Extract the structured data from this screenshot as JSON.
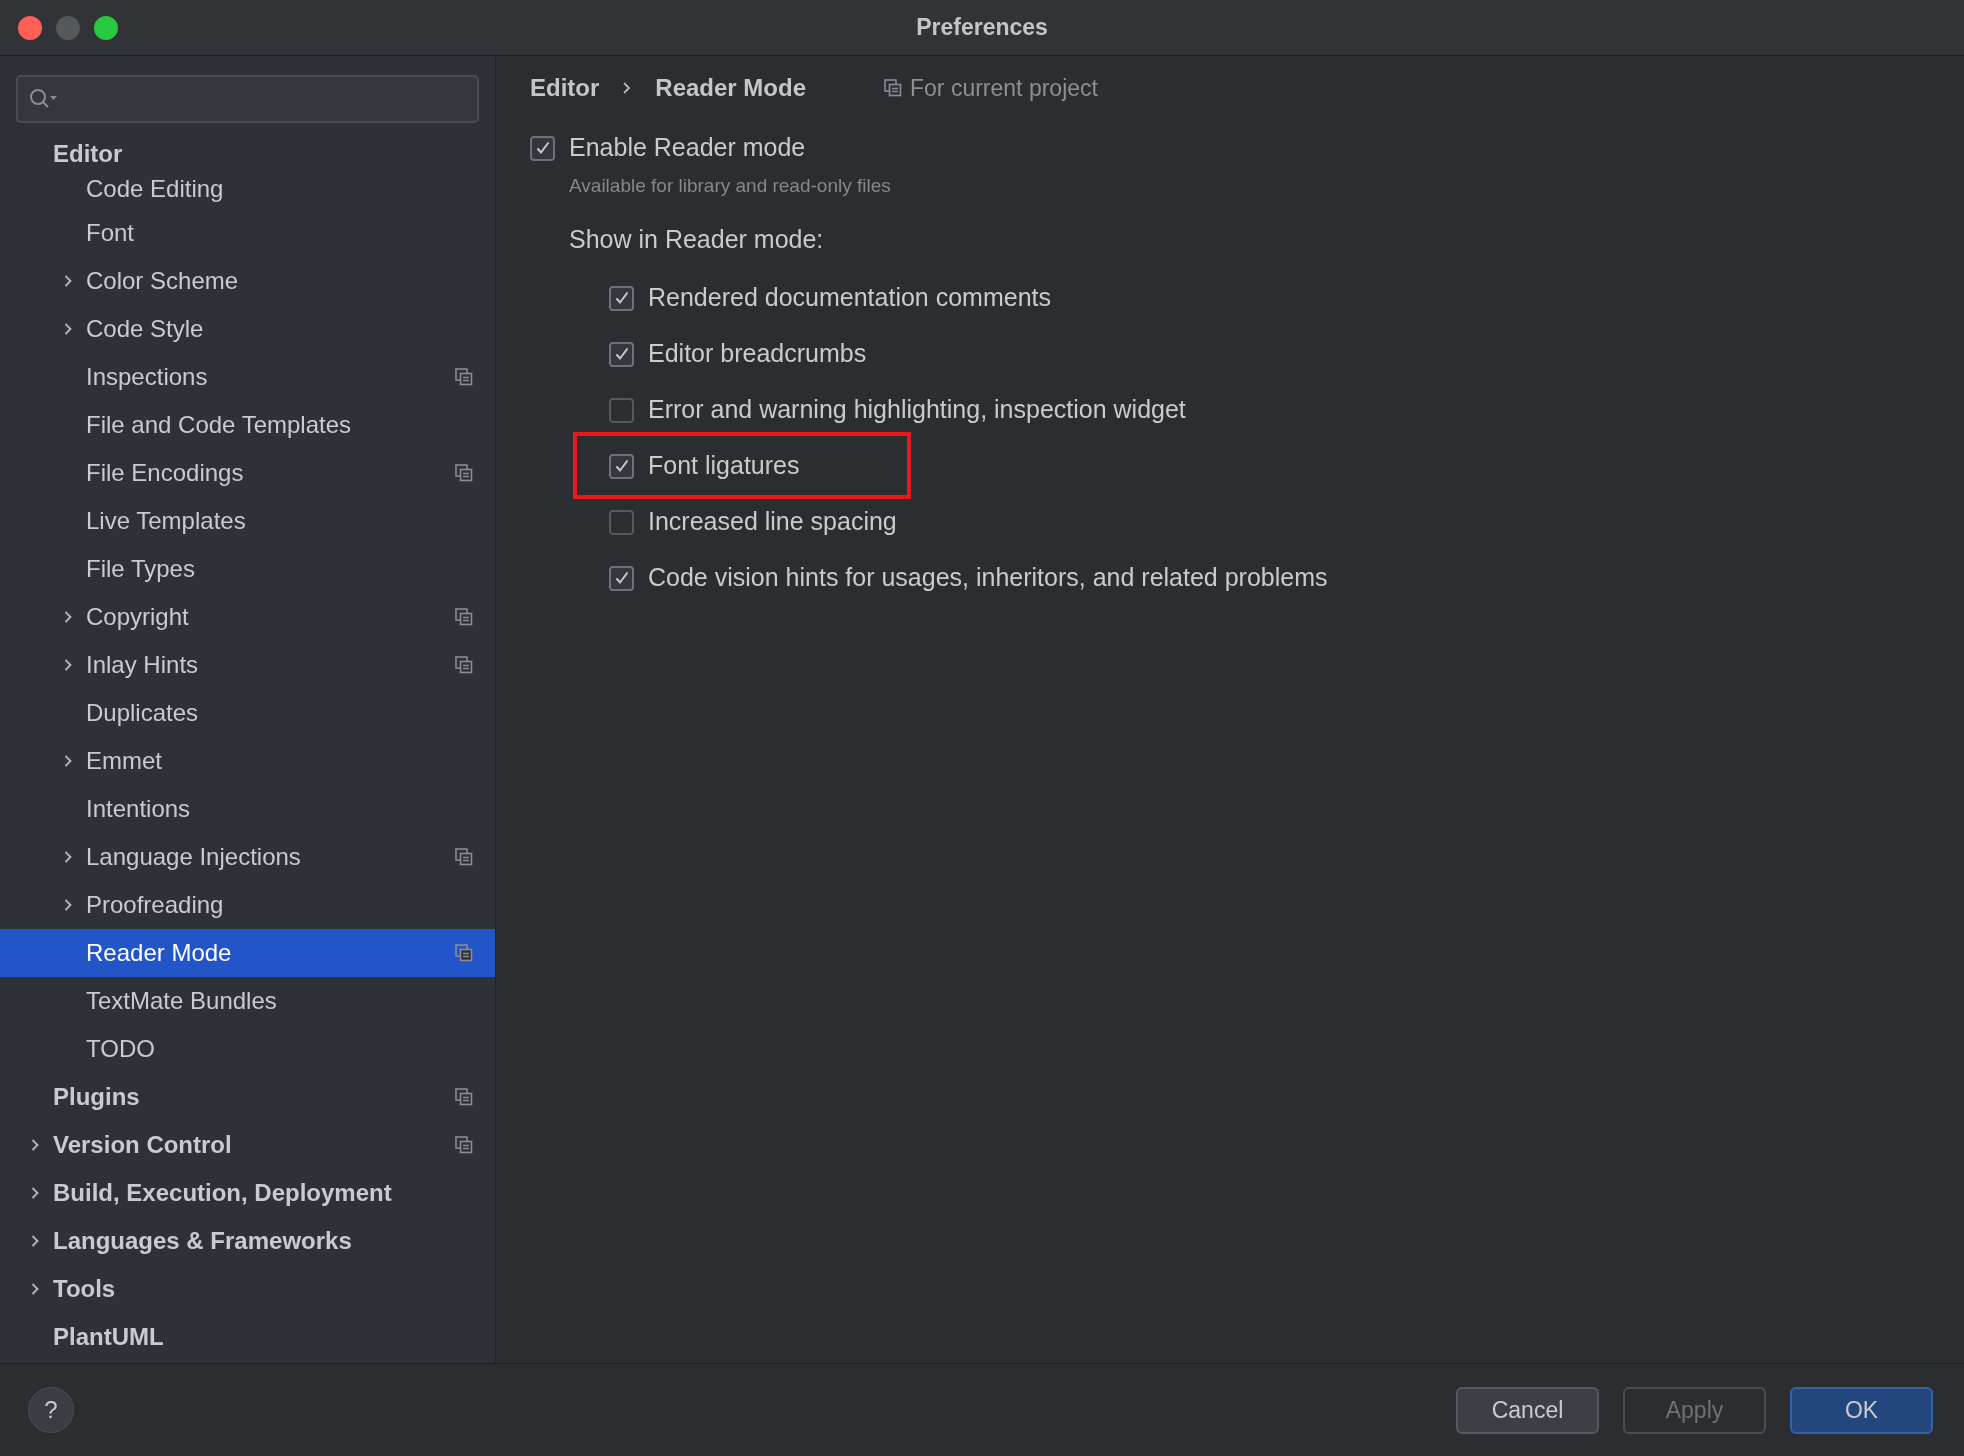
{
  "window": {
    "title": "Preferences"
  },
  "sidebar": {
    "items": [
      {
        "label": "Editor",
        "selected": false,
        "per_project": false,
        "children": [
          {
            "label": "Code Editing",
            "selected": false,
            "per_project": false
          },
          {
            "label": "Font",
            "selected": false,
            "per_project": false
          },
          {
            "label": "Color Scheme",
            "selected": false,
            "per_project": false,
            "expanded": false
          },
          {
            "label": "Code Style",
            "selected": false,
            "per_project": false,
            "expanded": false
          },
          {
            "label": "Inspections",
            "selected": false,
            "per_project": true
          },
          {
            "label": "File and Code Templates",
            "selected": false,
            "per_project": false
          },
          {
            "label": "File Encodings",
            "selected": false,
            "per_project": true
          },
          {
            "label": "Live Templates",
            "selected": false,
            "per_project": false
          },
          {
            "label": "File Types",
            "selected": false,
            "per_project": false
          },
          {
            "label": "Copyright",
            "selected": false,
            "per_project": true,
            "expanded": false
          },
          {
            "label": "Inlay Hints",
            "selected": false,
            "per_project": true,
            "expanded": false
          },
          {
            "label": "Duplicates",
            "selected": false,
            "per_project": false
          },
          {
            "label": "Emmet",
            "selected": false,
            "per_project": false,
            "expanded": false
          },
          {
            "label": "Intentions",
            "selected": false,
            "per_project": false
          },
          {
            "label": "Language Injections",
            "selected": false,
            "per_project": true,
            "expanded": false
          },
          {
            "label": "Proofreading",
            "selected": false,
            "per_project": false,
            "expanded": false
          },
          {
            "label": "Reader Mode",
            "selected": true,
            "per_project": true
          },
          {
            "label": "TextMate Bundles",
            "selected": false,
            "per_project": false
          },
          {
            "label": "TODO",
            "selected": false,
            "per_project": false
          }
        ]
      },
      {
        "label": "Plugins",
        "selected": false,
        "per_project": true
      },
      {
        "label": "Version Control",
        "selected": false,
        "per_project": true,
        "expanded": false
      },
      {
        "label": "Build, Execution, Deployment",
        "selected": false,
        "per_project": false,
        "expanded": false
      },
      {
        "label": "Languages & Frameworks",
        "selected": false,
        "per_project": false,
        "expanded": false
      },
      {
        "label": "Tools",
        "selected": false,
        "per_project": false,
        "expanded": false
      },
      {
        "label": "PlantUML",
        "selected": false,
        "per_project": false
      }
    ]
  },
  "breadcrumb": {
    "path": [
      "Editor",
      "Reader Mode"
    ],
    "scope": "For current project"
  },
  "enable": {
    "label": "Enable Reader mode",
    "checked": true,
    "hint": "Available for library and read-only files"
  },
  "show_in": {
    "heading": "Show in Reader mode:",
    "options": [
      {
        "label": "Rendered documentation comments",
        "checked": true,
        "highlighted": false
      },
      {
        "label": "Editor breadcrumbs",
        "checked": true,
        "highlighted": false
      },
      {
        "label": "Error and warning highlighting, inspection widget",
        "checked": false,
        "highlighted": false
      },
      {
        "label": "Font ligatures",
        "checked": true,
        "highlighted": true
      },
      {
        "label": "Increased line spacing",
        "checked": false,
        "highlighted": false
      },
      {
        "label": "Code vision hints for usages, inheritors, and related problems",
        "checked": true,
        "highlighted": false
      }
    ]
  },
  "help": {
    "label": "?"
  },
  "buttons": [
    {
      "label": "Cancel",
      "kind": "normal"
    },
    {
      "label": "Apply",
      "kind": "disabled"
    },
    {
      "label": "OK",
      "kind": "default"
    }
  ]
}
